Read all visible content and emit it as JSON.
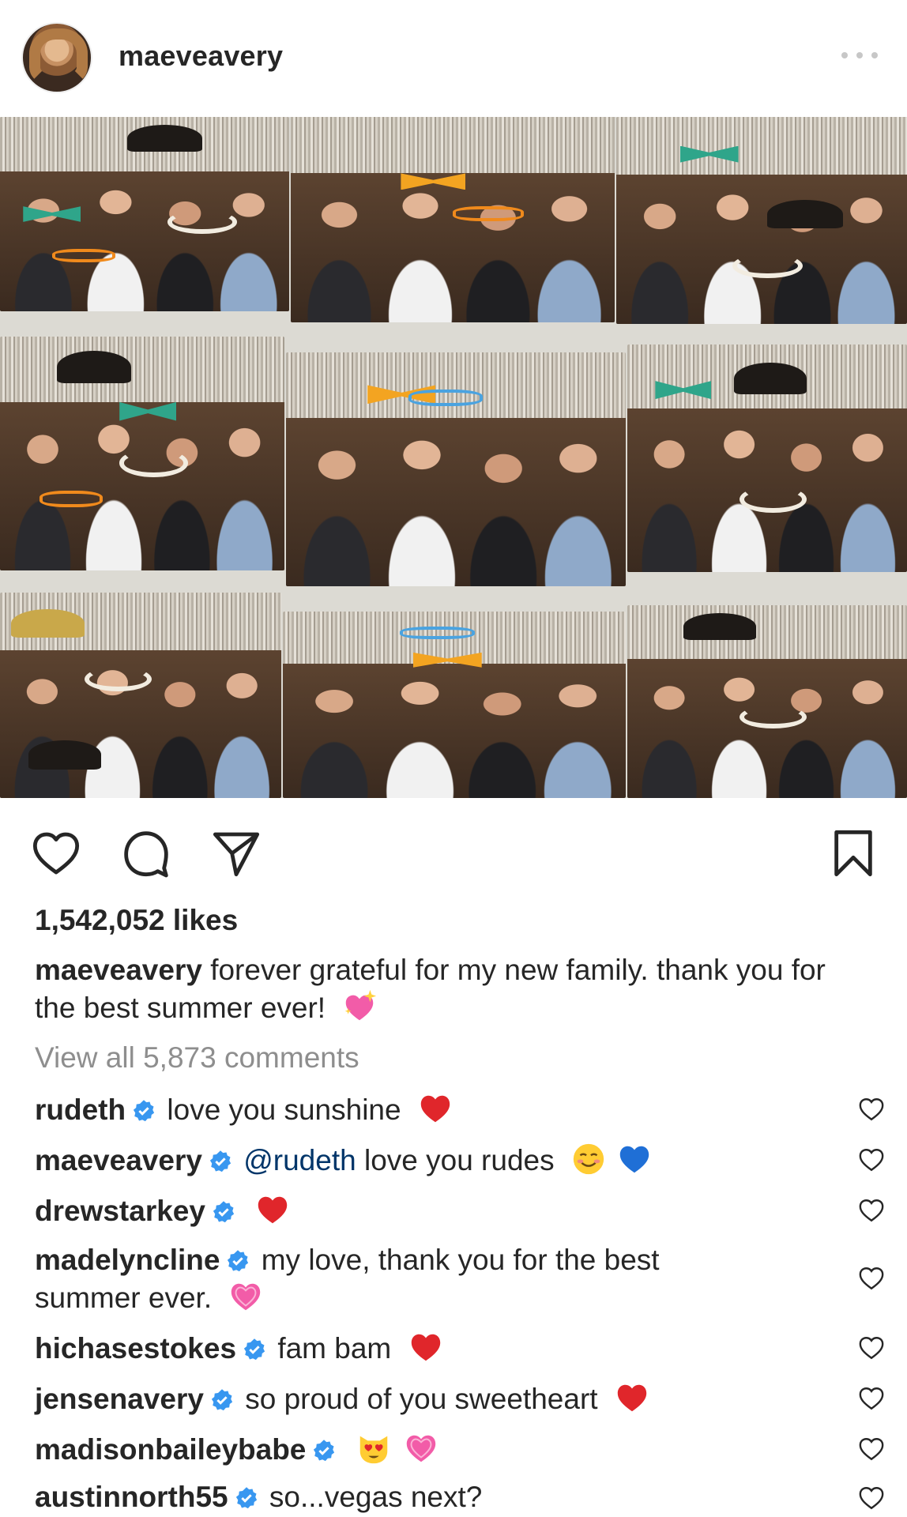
{
  "post": {
    "author": "maeveavery",
    "likes": "1,542,052 likes",
    "caption_user": "maeveavery",
    "caption_text": "forever grateful for my new family. thank you for the best summer ever!",
    "view_comments": "View all 5,873 comments"
  },
  "icons": {
    "like": "heart-outline-icon",
    "comment": "speech-bubble-icon",
    "share": "paper-plane-icon",
    "save": "bookmark-icon",
    "more": "ellipsis-icon",
    "verified": "verified-badge-icon"
  },
  "colors": {
    "text": "#262626",
    "muted": "#8e8e8e",
    "verified": "#3897f0",
    "mention": "#003569",
    "heart_red": "#e0262b",
    "heart_pink": "#f25ca8",
    "heart_blue": "#1f6fd6"
  },
  "comments": [
    {
      "user": "rudeth",
      "mention": "",
      "text": "love you sunshine",
      "emojis": [
        "red-heart"
      ]
    },
    {
      "user": "maeveavery",
      "mention": "@rudeth",
      "text": "love you rudes",
      "emojis": [
        "smiling-face",
        "blue-heart"
      ]
    },
    {
      "user": "drewstarkey",
      "mention": "",
      "text": "",
      "emojis": [
        "red-heart"
      ]
    },
    {
      "user": "madelyncline",
      "mention": "",
      "text": "my love, thank you for the best summer ever.",
      "emojis": [
        "pink-heart"
      ]
    },
    {
      "user": "hichasestokes",
      "mention": "",
      "text": "fam bam",
      "emojis": [
        "red-heart"
      ]
    },
    {
      "user": "jensenavery",
      "mention": "",
      "text": "so proud of you sweetheart",
      "emojis": [
        "red-heart"
      ]
    },
    {
      "user": "madisonbaileybabe",
      "mention": "",
      "text": "",
      "emojis": [
        "heart-eyes-cat",
        "pink-heart"
      ]
    },
    {
      "user": "austinnorth55",
      "mention": "",
      "text": "so...vegas next?",
      "emojis": []
    }
  ]
}
